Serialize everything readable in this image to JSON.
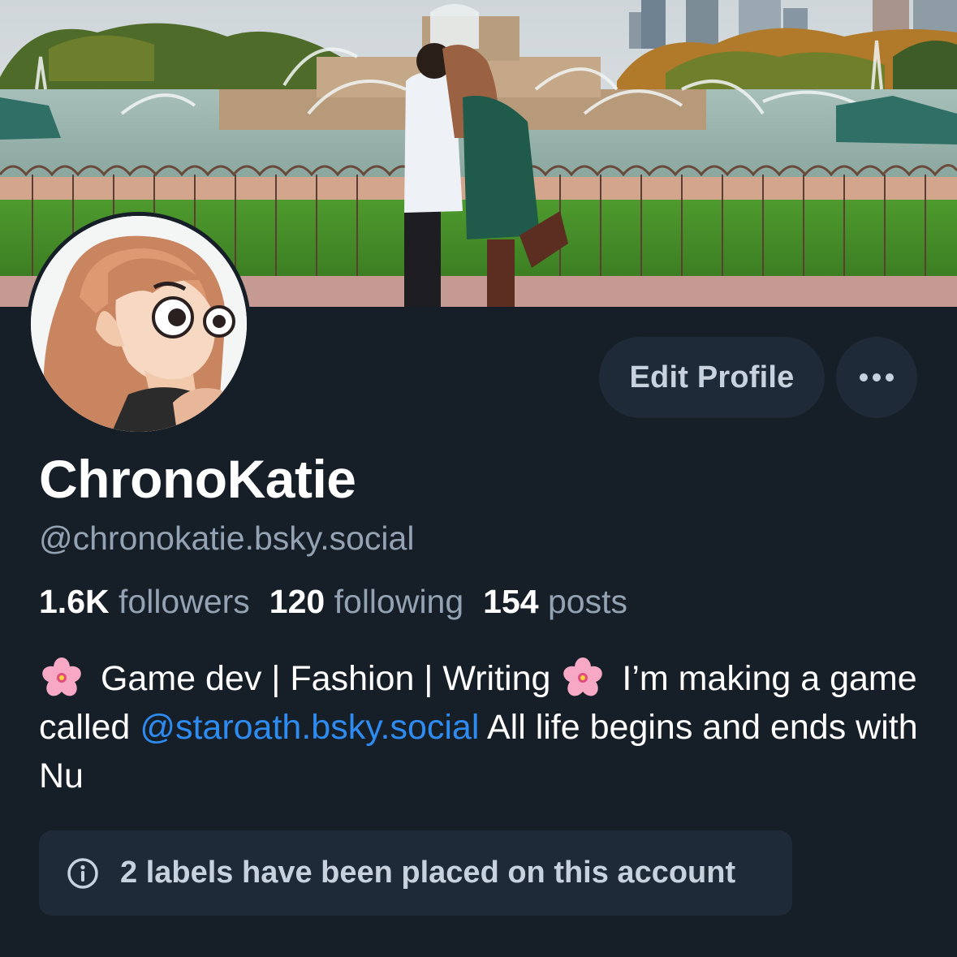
{
  "profile": {
    "display_name": "ChronoKatie",
    "handle": "@chronokatie.bsky.social",
    "stats": {
      "followers_count": "1.6K",
      "followers_label": "followers",
      "following_count": "120",
      "following_label": "following",
      "posts_count": "154",
      "posts_label": "posts"
    },
    "bio": {
      "part1": "Game dev | Fashion | Writing",
      "part2": "I’m making a game called",
      "mention": "@staroath.bsky.social",
      "part3": "All life begins and ends with Nu"
    }
  },
  "actions": {
    "edit_profile_label": "Edit Profile",
    "more_icon": "ellipsis-icon"
  },
  "labels_notice": {
    "icon": "info-icon",
    "text": "2 labels have been placed on this account"
  },
  "colors": {
    "background": "#161e27",
    "button_bg": "#1e2a37",
    "muted_text": "#94a3b3",
    "mention": "#2e8bf0"
  }
}
